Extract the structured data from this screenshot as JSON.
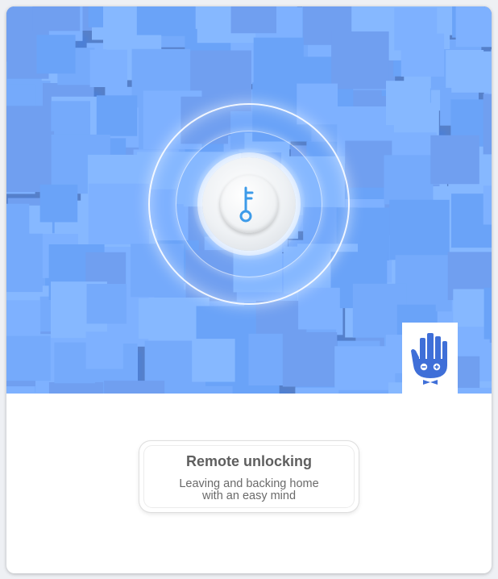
{
  "feature": {
    "title": "Remote unlocking",
    "subtitle_line1": "Leaving and backing home",
    "subtitle_line2": "with an easy mind"
  },
  "icons": {
    "unlock": "key-icon",
    "brand": "hand-robot-logo-icon"
  },
  "colors": {
    "hero_background": "#4f86e0",
    "tile_light": "#7eb1ff",
    "tile_mid": "#6aa3f8",
    "key_accent": "#3d9be9",
    "logo_blue": "#3f6fd8",
    "text": "#5f5f5f"
  }
}
